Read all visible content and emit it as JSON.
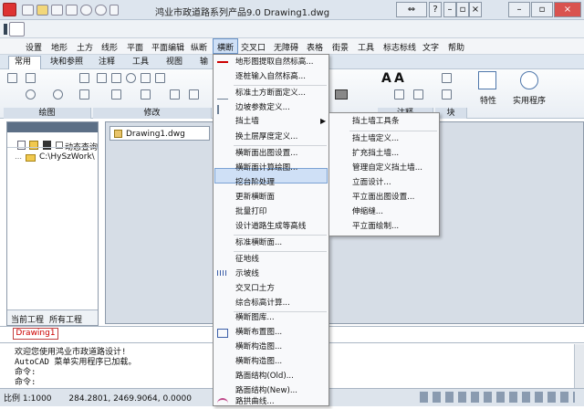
{
  "window": {
    "title": "鸿业市政道路系列产品9.0   Drawing1.dwg"
  },
  "menubar": {
    "items": [
      "设置",
      "地形",
      "土方",
      "线形",
      "平面",
      "平面编辑",
      "纵断",
      "横断",
      "交叉口",
      "无障碍",
      "表格",
      "街景",
      "工具",
      "标志标线",
      "文字",
      "帮助"
    ]
  },
  "ribbon": {
    "tabs": [
      "常用",
      "块和参照",
      "注释",
      "工具",
      "视图",
      "输"
    ],
    "panels": {
      "draw": "绘图",
      "modify": "修改",
      "annotate": "注释",
      "block": "块",
      "properties": "特性",
      "utilities": "实用程序"
    }
  },
  "left_panel": {
    "dynamic_query": "动态查询",
    "tree_root": "C:\\HySzWork\\",
    "tabs": [
      "当前工程",
      "所有工程"
    ]
  },
  "document": {
    "tab": "Drawing1.dwg",
    "layout_tab": "Drawing1"
  },
  "command": {
    "lines": [
      "欢迎您使用鸿业市政道路设计!",
      "AutoCAD 菜单实用程序已加载。",
      "命令:",
      "命令:"
    ]
  },
  "status": {
    "scale": "比例 1:1000",
    "coords": "284.2801,  2469.9064, 0.0000"
  },
  "dropdown": {
    "items": [
      {
        "label": "地形图提取自然标高...",
        "icon": "red-line-icon"
      },
      {
        "label": "逐桩输入自然标高..."
      },
      {
        "label": "标准土方断面定义...",
        "icon": "section-icon"
      },
      {
        "label": "边坡参数定义...",
        "icon": "slope-icon"
      },
      {
        "label": "挡土墙",
        "submenu": true
      },
      {
        "label": "换土层厚度定义..."
      },
      {
        "label": "横断面出图设置..."
      },
      {
        "label": "横断面计算绘图..."
      },
      {
        "label": "挖台阶处理"
      },
      {
        "label": "更新横断面"
      },
      {
        "label": "批量打印"
      },
      {
        "label": "设计道路生成等高线"
      },
      {
        "label": "标准横断面..."
      },
      {
        "label": "征地线"
      },
      {
        "label": "示坡线",
        "icon": "slope-line-icon"
      },
      {
        "label": "交叉口土方"
      },
      {
        "label": "综合标高计算..."
      },
      {
        "label": "横断图库..."
      },
      {
        "label": "横断布置图...",
        "icon": "layout-icon"
      },
      {
        "label": "横断构造图..."
      },
      {
        "label": "横断构造图..."
      },
      {
        "label": "路面结构(Old)..."
      },
      {
        "label": "路面结构(New)..."
      },
      {
        "label": "路拱曲线...",
        "icon": "arch-icon"
      }
    ]
  },
  "submenu": {
    "items": [
      "挡土墙工具条",
      "挡土墙定义...",
      "扩充挡土墙...",
      "管理自定义挡土墙...",
      "立面设计...",
      "平立面出图设置...",
      "伸缩缝...",
      "平立面绘制..."
    ]
  },
  "colors": {
    "accent": "#cfe0f6",
    "highlight_border": "#7ba2d4",
    "layout_tab_text": "#cc0000"
  }
}
